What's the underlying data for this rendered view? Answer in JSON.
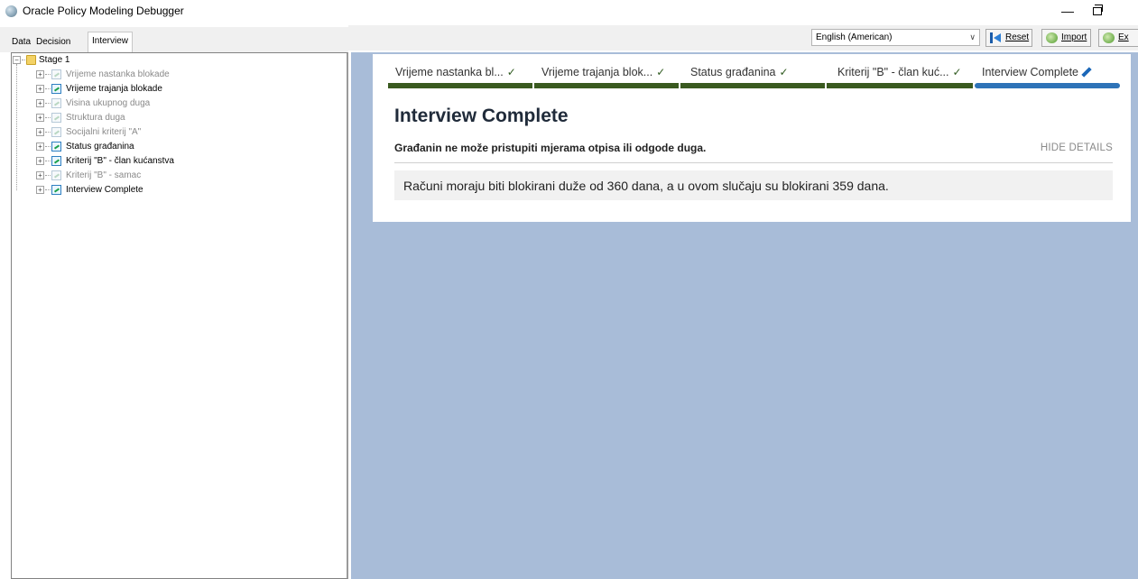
{
  "window": {
    "title": "Oracle Policy Modeling Debugger",
    "minimize_glyph": "—"
  },
  "tabs": [
    {
      "label": "Data"
    },
    {
      "label": "Decision"
    },
    {
      "label": "Interview"
    }
  ],
  "toolbar": {
    "language": "English (American)",
    "reset_label": "Reset",
    "import_label": "Import",
    "export_label": "Ex"
  },
  "tree": {
    "root": {
      "label": "Stage 1",
      "expand_glyph": "−"
    },
    "expand_glyph": "+",
    "items": [
      {
        "label": "Vrijeme nastanka blokade",
        "state": "inactive"
      },
      {
        "label": "Vrijeme trajanja blokade",
        "state": "active"
      },
      {
        "label": "Visina ukupnog duga",
        "state": "inactive"
      },
      {
        "label": "Struktura duga",
        "state": "inactive"
      },
      {
        "label": "Socijalni kriterij \"A\"",
        "state": "inactive"
      },
      {
        "label": "Status građanina",
        "state": "active"
      },
      {
        "label": "Kriterij \"B\" - član kućanstva",
        "state": "active"
      },
      {
        "label": "Kriterij \"B\" - samac",
        "state": "inactive"
      },
      {
        "label": "Interview Complete",
        "state": "active"
      }
    ]
  },
  "stages": [
    {
      "label": "Vrijeme nastanka bl...",
      "check": "✓"
    },
    {
      "label": "Vrijeme trajanja blok...",
      "check": "✓"
    },
    {
      "label": "Status građanina",
      "check": "✓"
    },
    {
      "label": "Kriterij \"B\" - član kuć...",
      "check": "✓"
    },
    {
      "label": "Interview Complete"
    }
  ],
  "main": {
    "title": "Interview Complete",
    "subtitle": "Građanin ne može pristupiti mjerama otpisa ili odgode duga.",
    "hide_details": "HIDE DETAILS",
    "detail": "Računi moraju biti blokirani duže od 360 dana, a u ovom slučaju su blokirani 359 dana."
  },
  "colors": {
    "completed_bar": "#3a5a20",
    "current_bar": "#2e73b8",
    "background": "#a8bcd8"
  }
}
